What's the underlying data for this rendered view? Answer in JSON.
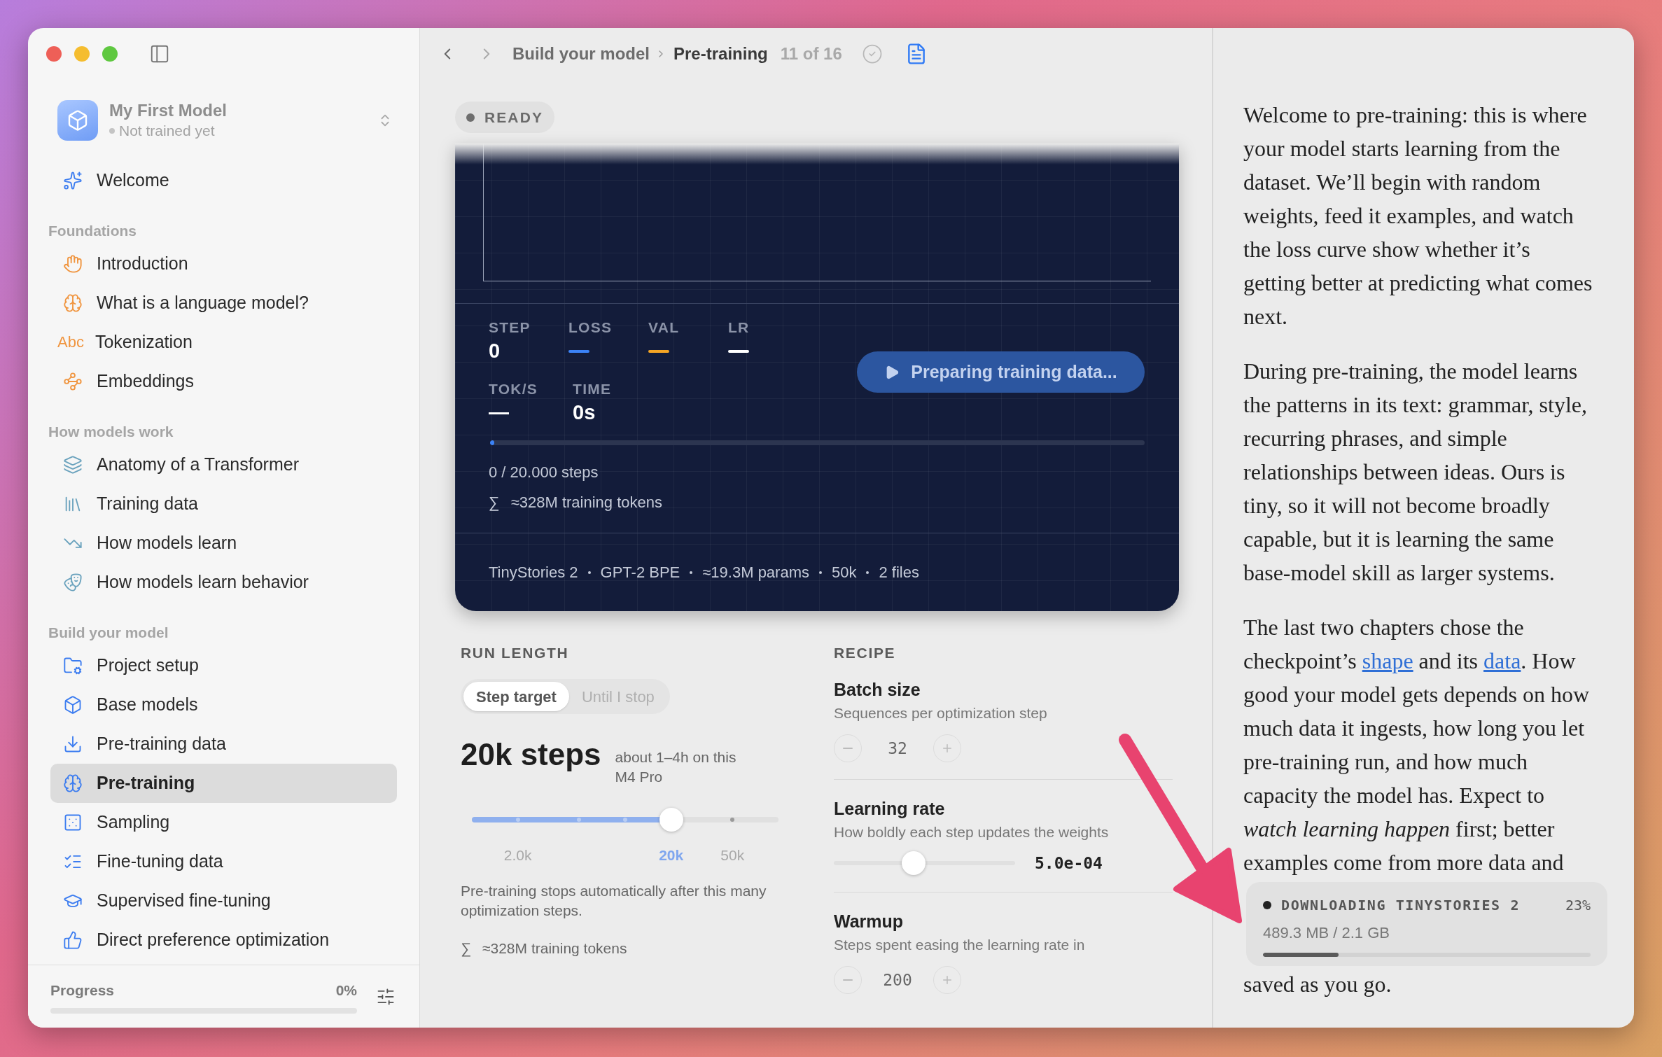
{
  "sidebar": {
    "project": {
      "title": "My First Model",
      "status": "Not trained yet"
    },
    "welcome": {
      "label": "Welcome",
      "selected": false
    },
    "sections": [
      {
        "title": "Foundations",
        "items": [
          {
            "label": "Introduction",
            "selected": false
          },
          {
            "label": "What is a language model?",
            "selected": false
          },
          {
            "label": "Tokenization",
            "icon_text": "Abc",
            "selected": false
          },
          {
            "label": "Embeddings",
            "selected": false
          }
        ]
      },
      {
        "title": "How models work",
        "items": [
          {
            "label": "Anatomy of a Transformer",
            "selected": false
          },
          {
            "label": "Training data",
            "selected": false
          },
          {
            "label": "How models learn",
            "selected": false
          },
          {
            "label": "How models learn behavior",
            "selected": false
          }
        ]
      },
      {
        "title": "Build your model",
        "items": [
          {
            "label": "Project setup",
            "selected": false
          },
          {
            "label": "Base models",
            "selected": false
          },
          {
            "label": "Pre-training data",
            "selected": false
          },
          {
            "label": "Pre-training",
            "selected": true
          },
          {
            "label": "Sampling",
            "selected": false
          },
          {
            "label": "Fine-tuning data",
            "selected": false
          },
          {
            "label": "Supervised fine-tuning",
            "selected": false
          },
          {
            "label": "Direct preference optimization",
            "selected": false
          }
        ]
      }
    ],
    "footer": {
      "label": "Progress",
      "value": "0%",
      "level": 0
    }
  },
  "toolbar": {
    "breadcrumb": [
      "Build your model",
      "Pre-training"
    ],
    "position": "11 of 16"
  },
  "status_badge": {
    "label": "READY"
  },
  "training_panel": {
    "stats": [
      [
        {
          "label": "STEP",
          "kind": "text",
          "value": "0"
        },
        {
          "label": "LOSS",
          "kind": "swatch",
          "color": "#3b82f6"
        },
        {
          "label": "VAL",
          "kind": "swatch",
          "color": "#f5a524"
        },
        {
          "label": "LR",
          "kind": "swatch",
          "color": "#ffffff"
        }
      ],
      [
        {
          "label": "TOK/S",
          "kind": "text",
          "value": "—"
        },
        {
          "label": "TIME",
          "kind": "text",
          "value": "0s"
        }
      ]
    ],
    "start_button": {
      "label": "Preparing training data...",
      "disabled": true
    },
    "progress": {
      "level": 0.004,
      "caption": "0 / 20.000 steps"
    },
    "tokens": {
      "symbol": "∑",
      "text": "≈328M training tokens"
    },
    "summary": [
      "TinyStories 2",
      "GPT-2 BPE",
      "≈19.3M params",
      "50k",
      "2 files"
    ]
  },
  "run_length": {
    "title": "RUN LENGTH",
    "modes": [
      {
        "label": "Step target",
        "selected": true
      },
      {
        "label": "Until I stop",
        "selected": false
      }
    ],
    "value": "20k steps",
    "estimate": "about 1–4h on this M4 Pro",
    "slider": {
      "level": 0.65,
      "ticks": [
        {
          "label": "2.0k",
          "selected": false
        },
        {
          "label": "20k",
          "selected": true
        },
        {
          "label": "50k",
          "selected": false
        }
      ]
    },
    "description": "Pre-training stops automatically after this many optimization steps.",
    "tokens": {
      "symbol": "∑",
      "text": "≈328M training tokens"
    }
  },
  "recipe": {
    "title": "RECIPE",
    "settings": [
      {
        "kind": "stepper",
        "name": "Batch size",
        "description": "Sequences per optimization step",
        "value": "32"
      },
      {
        "kind": "slider",
        "name": "Learning rate",
        "description": "How boldly each step updates the weights",
        "level": 0.44,
        "value": "5.0e-04"
      },
      {
        "kind": "stepper",
        "name": "Warmup",
        "description": "Steps spent easing the learning rate in",
        "value": "200"
      }
    ]
  },
  "article": {
    "paragraphs": [
      [
        {
          "kind": "text",
          "text": "Welcome to pre-training: this is where your model starts learning from the dataset. We’ll begin with random weights, feed it examples, and watch the loss curve show whether it’s getting better at predicting what comes next."
        }
      ],
      [
        {
          "kind": "text",
          "text": "During pre-training, the model learns the patterns in its text: grammar, style, recurring phrases, and simple relationships between ideas. Ours is tiny, so it will not become broadly capable, but it is learning the same base-model skill as larger systems."
        }
      ],
      [
        {
          "kind": "text",
          "text": "The last two chapters chose the checkpoint’s "
        },
        {
          "kind": "link",
          "text": "shape"
        },
        {
          "kind": "text",
          "text": " and its "
        },
        {
          "kind": "link",
          "text": "data"
        },
        {
          "kind": "text",
          "text": ". How good your model gets depends on how much data it ingests, how long you let pre-training run, and how much capacity the model has. Expect to *watch learning happen* first; better examples come from more data and"
        }
      ]
    ],
    "download": {
      "title": "DOWNLOADING TINYSTORIES 2",
      "percent": "23%",
      "size": "489.3 MB / 2.1 GB",
      "level": 0.23
    },
    "closing": "saved as you go."
  }
}
